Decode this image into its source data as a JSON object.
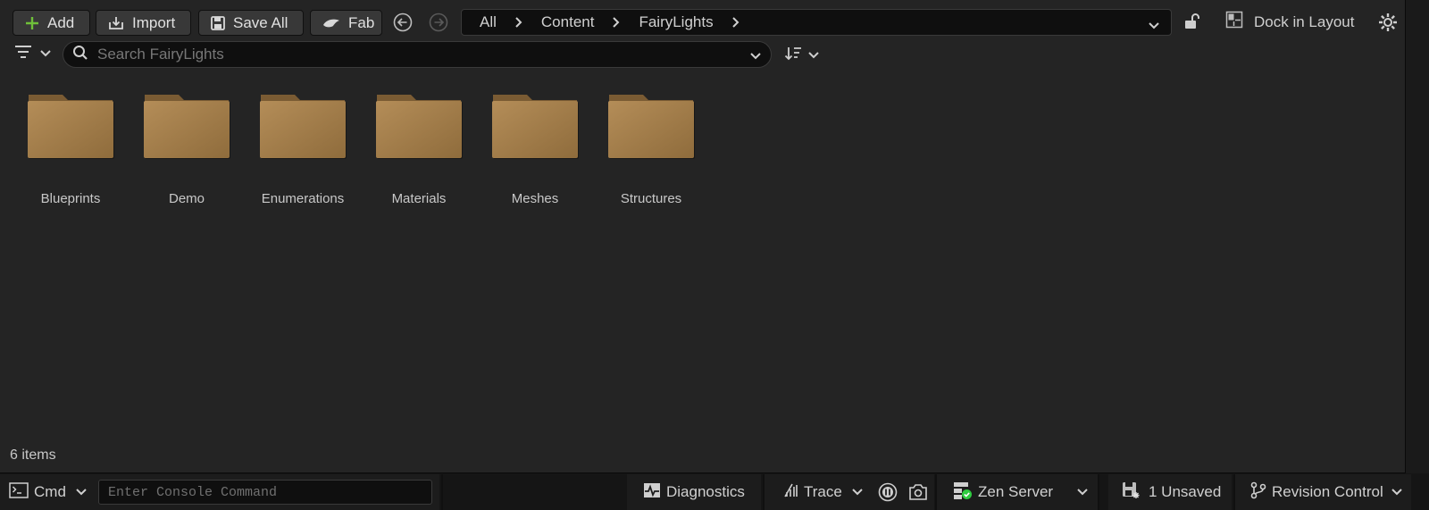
{
  "toolbar": {
    "add_label": "Add",
    "import_label": "Import",
    "save_all_label": "Save All",
    "fab_label": "Fab",
    "dock_label": "Dock in Layout"
  },
  "breadcrumb": [
    "All",
    "Content",
    "FairyLights"
  ],
  "search": {
    "placeholder": "Search FairyLights",
    "value": ""
  },
  "folders": [
    "Blueprints",
    "Demo",
    "Enumerations",
    "Materials",
    "Meshes",
    "Structures"
  ],
  "item_count": "6 items",
  "statusbar": {
    "cmd_label": "Cmd",
    "console_placeholder": "Enter Console Command",
    "diagnostics_label": "Diagnostics",
    "trace_label": "Trace",
    "zen_label": "Zen Server",
    "unsaved_label": "1 Unsaved",
    "revision_label": "Revision Control"
  },
  "colors": {
    "folder": "#a8834f",
    "add_accent": "#6fbf3a",
    "zen_ok": "#2ecc40"
  },
  "icons": [
    "plus-icon",
    "import-icon",
    "save-icon",
    "fab-icon",
    "back-arrow-icon",
    "forward-arrow-icon",
    "chevron-right-icon",
    "chevron-down-icon",
    "lock-icon",
    "layout-icon",
    "gear-icon",
    "filter-icon",
    "search-icon",
    "sort-icon",
    "folder-icon",
    "terminal-icon",
    "diagnostics-icon",
    "trace-icon",
    "record-icon",
    "screenshot-icon",
    "zen-server-icon",
    "unsaved-icon",
    "branch-icon"
  ]
}
